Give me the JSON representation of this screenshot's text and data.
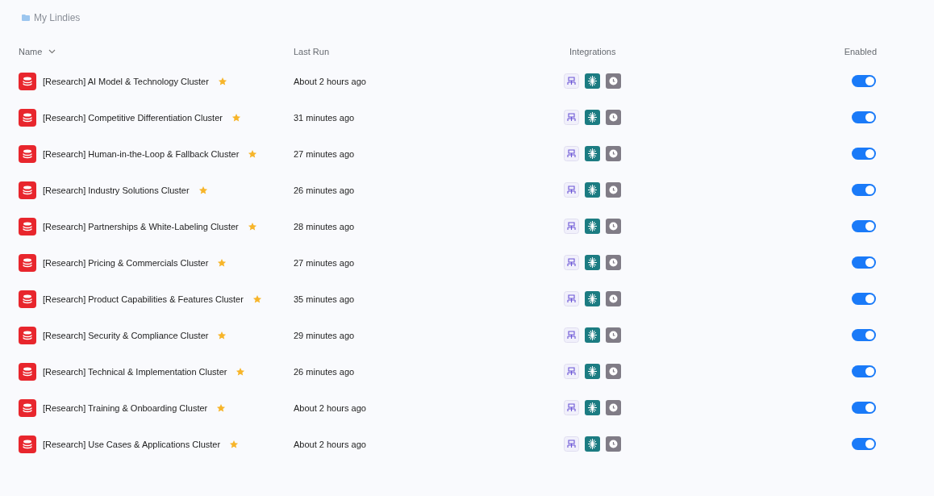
{
  "breadcrumb": {
    "label": "My Lindies"
  },
  "columns": [
    {
      "label": "Name",
      "sortable": true
    },
    {
      "label": "Last Run",
      "sortable": false
    },
    {
      "label": "Integrations",
      "sortable": false
    },
    {
      "label": "Enabled",
      "sortable": false
    }
  ],
  "rows": [
    {
      "name": "[Research] AI Model & Technology Cluster",
      "starred": true,
      "last_run": "About 2 hours ago",
      "enabled": true
    },
    {
      "name": "[Research] Competitive Differentiation Cluster",
      "starred": true,
      "last_run": "31 minutes ago",
      "enabled": true
    },
    {
      "name": "[Research] Human-in-the-Loop & Fallback Cluster",
      "starred": true,
      "last_run": "27 minutes ago",
      "enabled": true
    },
    {
      "name": "[Research] Industry Solutions Cluster",
      "starred": true,
      "last_run": "26 minutes ago",
      "enabled": true
    },
    {
      "name": "[Research] Partnerships & White-Labeling Cluster",
      "starred": true,
      "last_run": "28 minutes ago",
      "enabled": true
    },
    {
      "name": "[Research] Pricing & Commercials Cluster",
      "starred": true,
      "last_run": "27 minutes ago",
      "enabled": true
    },
    {
      "name": "[Research] Product Capabilities & Features Cluster",
      "starred": true,
      "last_run": "35 minutes ago",
      "enabled": true
    },
    {
      "name": "[Research] Security & Compliance Cluster",
      "starred": true,
      "last_run": "29 minutes ago",
      "enabled": true
    },
    {
      "name": "[Research] Technical & Implementation Cluster",
      "starred": true,
      "last_run": "26 minutes ago",
      "enabled": true
    },
    {
      "name": "[Research] Training & Onboarding Cluster",
      "starred": true,
      "last_run": "About 2 hours ago",
      "enabled": true
    },
    {
      "name": "[Research] Use Cases & Applications Cluster",
      "starred": true,
      "last_run": "About 2 hours ago",
      "enabled": true
    }
  ]
}
